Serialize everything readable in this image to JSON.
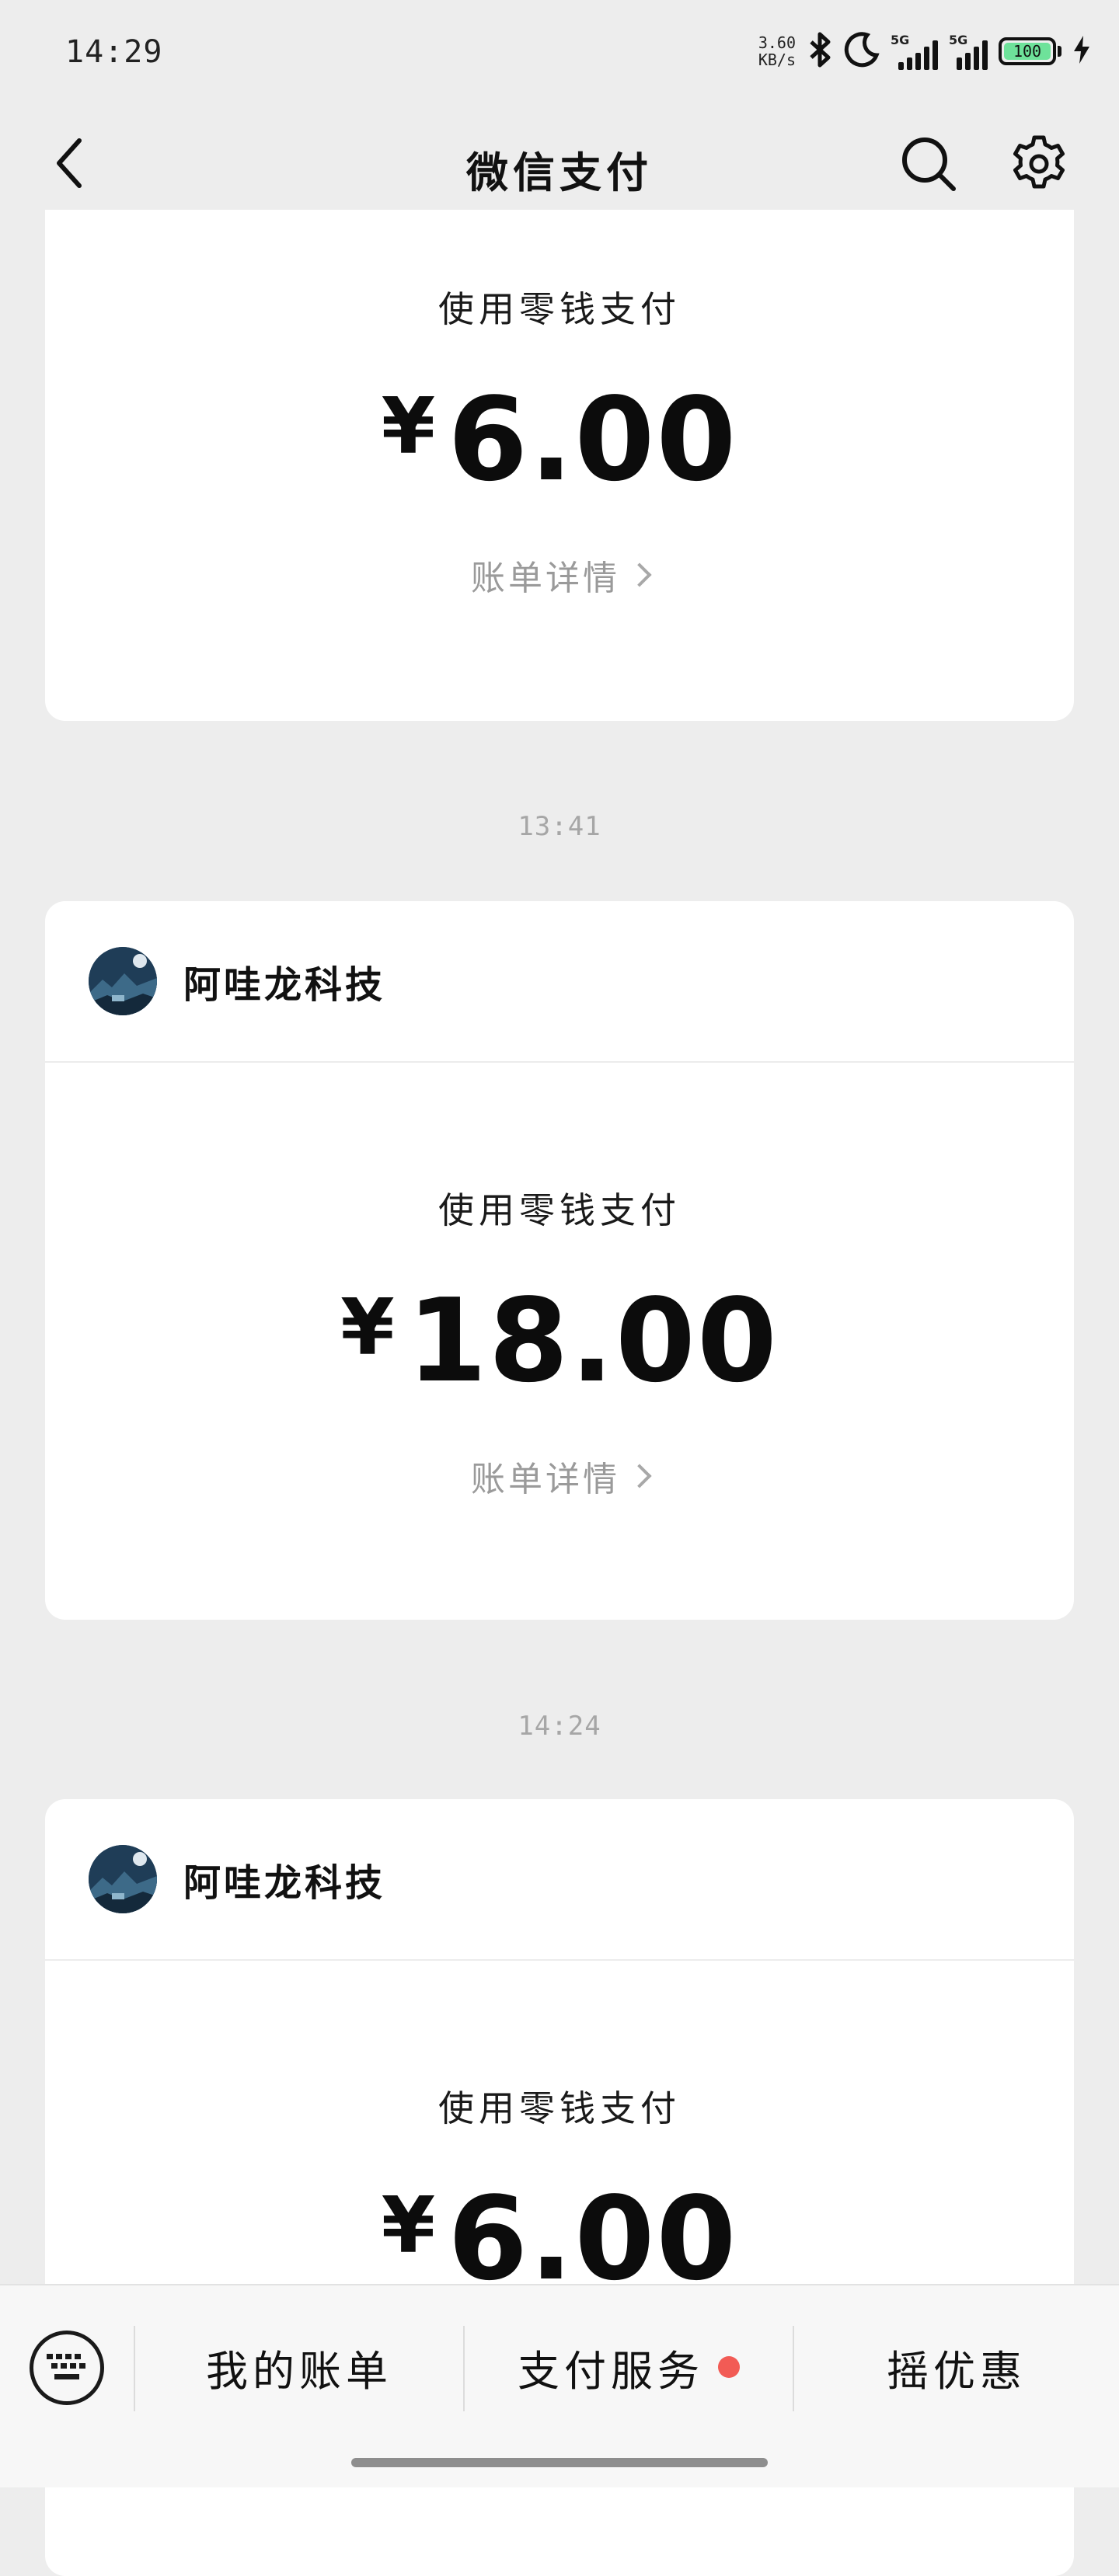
{
  "status_bar": {
    "time": "14:29",
    "net_speed_value": "3.60",
    "net_speed_unit": "KB/s",
    "sim1_label": "5G",
    "sim2_label": "5G",
    "battery": "100",
    "icons": [
      "bluetooth-icon",
      "moon-icon",
      "signal-icon",
      "battery-icon",
      "charging-icon"
    ]
  },
  "nav": {
    "title": "微信支付",
    "icons": [
      "back-icon",
      "search-icon",
      "gear-icon"
    ]
  },
  "messages": [
    {
      "pay_method": "使用零钱支付",
      "currency": "¥",
      "amount": "6.00",
      "detail": "账单详情"
    },
    {
      "time": "13:41",
      "merchant": "阿哇龙科技",
      "pay_method": "使用零钱支付",
      "currency": "¥",
      "amount": "18.00",
      "detail": "账单详情"
    },
    {
      "time": "14:24",
      "merchant": "阿哇龙科技",
      "pay_method": "使用零钱支付",
      "currency": "¥",
      "amount": "6.00"
    }
  ],
  "bottom_menu": {
    "items": [
      {
        "label": "我的账单"
      },
      {
        "label": "支付服务",
        "badge": "red-dot"
      },
      {
        "label": "摇优惠"
      }
    ]
  },
  "colors": {
    "background": "#ededed",
    "card": "#ffffff",
    "badge": "#f25b55",
    "battery_fill": "#6ee29a"
  }
}
